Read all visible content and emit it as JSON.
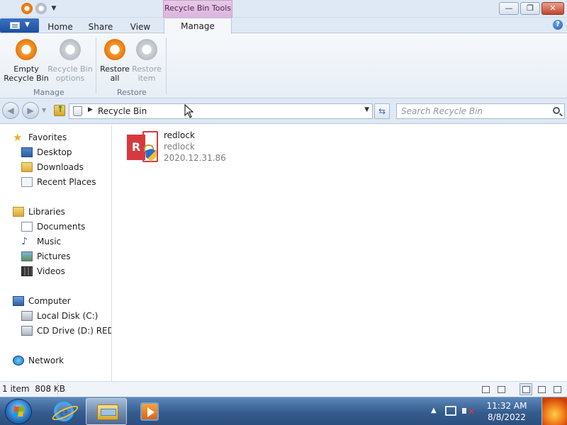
{
  "titlebar": {
    "context_tab": "Recycle Bin Tools",
    "controls": {
      "minimize": "—",
      "maximize": "❐",
      "close": "✕"
    }
  },
  "ribbon_tabs": {
    "home": "Home",
    "share": "Share",
    "view": "View",
    "manage": "Manage",
    "help": "?"
  },
  "ribbon": {
    "empty_recycle_bin": "Empty\nRecycle Bin",
    "recycle_bin_options": "Recycle Bin\noptions",
    "restore_all": "Restore\nall",
    "restore_item": "Restore\nitem",
    "group_manage": "Manage",
    "group_restore": "Restore"
  },
  "address": {
    "path": "Recycle Bin",
    "search_placeholder": "Search Recycle Bin"
  },
  "nav": {
    "favorites": "Favorites",
    "desktop": "Desktop",
    "downloads": "Downloads",
    "recent_places": "Recent Places",
    "libraries": "Libraries",
    "documents": "Documents",
    "music": "Music",
    "pictures": "Pictures",
    "videos": "Videos",
    "computer": "Computer",
    "local_disk": "Local Disk (C:)",
    "cd_drive": "CD Drive (D:) REDPILL",
    "network": "Network"
  },
  "files": [
    {
      "name": "redlock",
      "subtitle": "redlock",
      "version": "2020.12.31.86",
      "icon_letter": "R"
    }
  ],
  "statusbar": {
    "count": "1 item",
    "size": "808 KB"
  },
  "taskbar": {
    "time": "11:32 AM",
    "date": "8/8/2022"
  },
  "colors": {
    "accent": "#1d4f9d",
    "context_tab": "#dcb5dd",
    "restore_orange": "#e2700d",
    "redlock_red": "#d73a3e"
  }
}
